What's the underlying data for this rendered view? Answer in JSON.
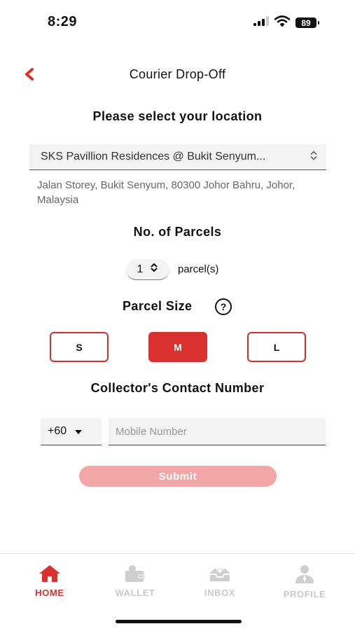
{
  "status_bar": {
    "time": "8:29",
    "battery": "89"
  },
  "header": {
    "title": "Courier Drop-Off"
  },
  "location": {
    "heading": "Please select your location",
    "selected": "SKS Pavillion Residences @ Bukit Senyum...",
    "address": "Jalan Storey, Bukit Senyum, 80300 Johor Bahru, Johor, Malaysia"
  },
  "parcels": {
    "heading": "No. of Parcels",
    "count": "1",
    "unit": "parcel(s)"
  },
  "parcel_size": {
    "heading": "Parcel Size",
    "help": "?",
    "options": [
      "S",
      "M",
      "L"
    ],
    "selected": "M"
  },
  "contact": {
    "heading": "Collector's Contact Number",
    "country_code": "+60",
    "placeholder": "Mobile Number",
    "value": ""
  },
  "submit": {
    "label": "Submit"
  },
  "tabs": [
    {
      "label": "HOME",
      "icon": "home-icon"
    },
    {
      "label": "WALLET",
      "icon": "wallet-icon"
    },
    {
      "label": "INBOX",
      "icon": "inbox-icon"
    },
    {
      "label": "PROFILE",
      "icon": "profile-icon"
    }
  ],
  "colors": {
    "accent": "#d9322e",
    "submit_disabled": "#f2a6a6",
    "inactive_tab": "#c9c9c9"
  }
}
